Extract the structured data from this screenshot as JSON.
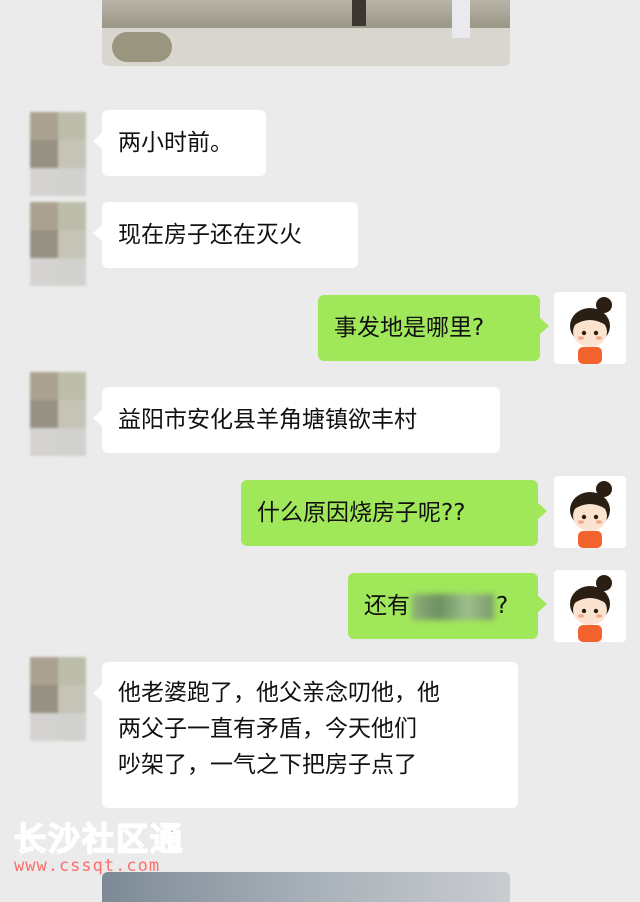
{
  "messages": [
    {
      "id": "m1",
      "side": "in",
      "text": "两小时前。"
    },
    {
      "id": "m2",
      "side": "in",
      "text": "现在房子还在灭火"
    },
    {
      "id": "m3",
      "side": "out",
      "text": "事发地是哪里?"
    },
    {
      "id": "m4",
      "side": "in",
      "text": "益阳市安化县羊角塘镇欲丰村"
    },
    {
      "id": "m5",
      "side": "out",
      "text": "什么原因烧房子呢??"
    },
    {
      "id": "m6",
      "side": "out",
      "text_before": "还有",
      "text_after": "?"
    },
    {
      "id": "m7",
      "side": "in",
      "lines": [
        "他老婆跑了，他父亲念叨他，他",
        "两父子一直有矛盾，今天他们",
        "吵架了，一气之下把房子点了"
      ]
    }
  ],
  "watermark": {
    "title": "长沙社区通",
    "url": "www.cssqt.com"
  },
  "colors": {
    "background": "#ebebeb",
    "incoming_bubble": "#ffffff",
    "outgoing_bubble": "#a0e75a",
    "watermark": "#ff6d6d"
  }
}
